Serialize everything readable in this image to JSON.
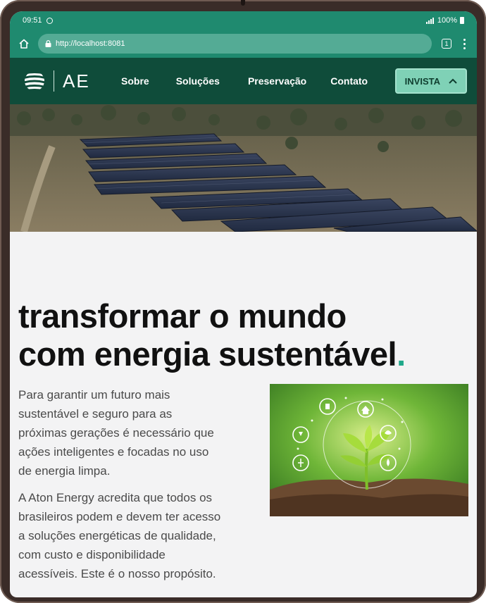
{
  "status_bar": {
    "time": "09:51",
    "battery": "100%"
  },
  "browser": {
    "url": "http://localhost:8081",
    "tab_count": "1"
  },
  "navbar": {
    "logo_text": "AE",
    "links": [
      "Sobre",
      "Soluções",
      "Preservação",
      "Contato"
    ],
    "invest_label": "INVISTA"
  },
  "main": {
    "headline_line1": "transformar o mundo",
    "headline_line2": "com energia sustentável",
    "headline_dot": ".",
    "paragraph1": "Para garantir um futuro mais sustentável e seguro para as próximas gerações é necessário que ações inteligentes e focadas no uso de energia limpa.",
    "paragraph2": "A Aton Energy acredita que todos os brasileiros podem e devem ter acesso a soluções energéticas de qualidade, com custo e disponibilidade acessíveis. Este é o nosso propósito."
  },
  "colors": {
    "brand_dark": "#0f4c3a",
    "brand_bar": "#1f8a6f",
    "accent": "#1fa88a",
    "button": "#7fd1b6"
  }
}
